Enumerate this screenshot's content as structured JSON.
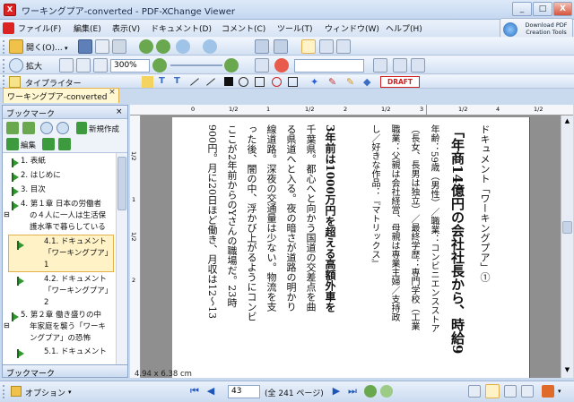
{
  "window": {
    "title": "ワーキングプア-converted - PDF-XChange Viewer",
    "minimize": "_",
    "maximize": "□",
    "close": "X"
  },
  "menu": [
    "ファイル(F)",
    "編集(E)",
    "表示(V)",
    "ドキュメント(D)",
    "コメント(C)",
    "ツール(T)",
    "ウィンドウ(W)",
    "ヘルプ(H)"
  ],
  "download": {
    "label": "Download PDF Creation Tools"
  },
  "toolbar1": {
    "open": "開く(O)..."
  },
  "toolbar2": {
    "zoom_tool": "拡大",
    "zoom_value": "300%"
  },
  "toolbar3": {
    "typewriter": "タイプライター",
    "stamp": "DRAFT"
  },
  "tab": {
    "label": "ワーキングプア-converted",
    "close": "×"
  },
  "bookmarks": {
    "header": "ブックマーク",
    "new": "新規作成",
    "edit": "編集",
    "items": [
      "1. 表紙",
      "2. はじめに",
      "3. 目次",
      "4. 第１章 日本の労働者",
      "の４人に一人は生活保",
      "護水準で暮らしている",
      "4.1. ドキュメント",
      "「ワーキングプア」",
      "1",
      "4.2. ドキュメント",
      "「ワーキングプア」",
      "2",
      "5. 第２章 働き盛りの中",
      "年家庭を襲う「ワーキ",
      "ングプア」の恐怖",
      "5.1. ドキュメント"
    ],
    "footer": "ブックマーク"
  },
  "document": {
    "dimensions": "4.94 x 6.38 cm",
    "ruler_h": [
      "0",
      "1/2",
      "1",
      "1/2",
      "2",
      "1/2",
      "3",
      "1/2",
      "4",
      "1/2"
    ],
    "ruler_v": [
      "1/2",
      "1",
      "1/2",
      "2"
    ],
    "columns": [
      "ドキュメント「ワーキングプア」①",
      "「年商14億円の会社社長から、時給9",
      "年齢：59歳（男性）／職業：コンビニエンスストア",
      "（長女、長男は独立）／最終学歴：専門学校（工業",
      "職業：父親は会社経営、母親は専業主婦／支持政",
      "し／好きな作品：『マトリックス』",
      "3年前は1000万円を超える高額外車を",
      "千葉県。都心へと向かう国道の交差点を曲",
      "る県道へと入る。夜の暗さが道路の明かり",
      "線道路。深夜の交通量は少ない。物流を支",
      "った後、闇の中、浮かび上がるようにコンビ",
      "ここが2年前からのYさんの職場だ。23時",
      "900円。月に20日ほど働き、月収は12〜13"
    ]
  },
  "bottom": {
    "options": "オプション",
    "page_current": "43",
    "page_total": "(全 241 ページ)"
  }
}
